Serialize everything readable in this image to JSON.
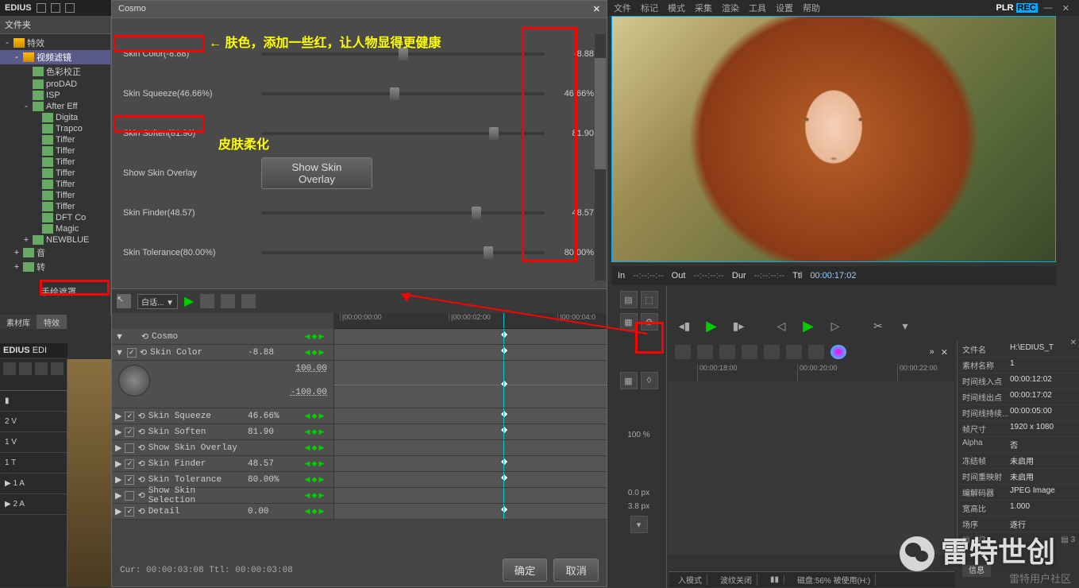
{
  "app": {
    "name": "EDIUS",
    "sub": "EDI"
  },
  "topmenu": [
    "文件",
    "标记",
    "模式",
    "采集",
    "渲染",
    "工具",
    "设置",
    "帮助"
  ],
  "plr": {
    "p": "PLR ",
    "rec": "REC"
  },
  "sidebar": {
    "header": "文件夹",
    "items": [
      {
        "indent": 0,
        "exp": "-",
        "ico": "folder",
        "label": "特效"
      },
      {
        "indent": 1,
        "exp": "-",
        "ico": "folder",
        "label": "视频滤镜",
        "sel": true
      },
      {
        "indent": 2,
        "exp": "",
        "ico": "fx",
        "label": "色彩校正"
      },
      {
        "indent": 2,
        "exp": "",
        "ico": "fx",
        "label": "proDAD"
      },
      {
        "indent": 2,
        "exp": "",
        "ico": "fx",
        "label": "ISP"
      },
      {
        "indent": 2,
        "exp": "-",
        "ico": "fx",
        "label": "After Eff"
      },
      {
        "indent": 3,
        "exp": "",
        "ico": "fx",
        "label": "Digita"
      },
      {
        "indent": 3,
        "exp": "",
        "ico": "fx",
        "label": "Trapco"
      },
      {
        "indent": 3,
        "exp": "",
        "ico": "fx",
        "label": "Tiffer"
      },
      {
        "indent": 3,
        "exp": "",
        "ico": "fx",
        "label": "Tiffer"
      },
      {
        "indent": 3,
        "exp": "",
        "ico": "fx",
        "label": "Tiffer"
      },
      {
        "indent": 3,
        "exp": "",
        "ico": "fx",
        "label": "Tiffer"
      },
      {
        "indent": 3,
        "exp": "",
        "ico": "fx",
        "label": "Tiffer"
      },
      {
        "indent": 3,
        "exp": "",
        "ico": "fx",
        "label": "Tiffer"
      },
      {
        "indent": 3,
        "exp": "",
        "ico": "fx",
        "label": "Tiffer"
      },
      {
        "indent": 3,
        "exp": "",
        "ico": "fx",
        "label": "DFT Co"
      },
      {
        "indent": 3,
        "exp": "",
        "ico": "fx",
        "label": "Magic"
      },
      {
        "indent": 2,
        "exp": "+",
        "ico": "fx",
        "label": "NEWBLUE"
      },
      {
        "indent": 1,
        "exp": "+",
        "ico": "fx",
        "label": "音"
      },
      {
        "indent": 1,
        "exp": "+",
        "ico": "fx",
        "label": "转"
      }
    ],
    "handdrawn_mask": "手绘遮罩",
    "tabs": [
      "素材库",
      "特效"
    ]
  },
  "cosmo": {
    "title": "Cosmo",
    "params": [
      {
        "label": "Skin Color(-8.88)",
        "pos": 50,
        "val": "-8.88"
      },
      {
        "label": "Skin Squeeze(46.66%)",
        "pos": 47,
        "val": "46.66%"
      },
      {
        "label": "Skin Soften(81.90)",
        "pos": 82,
        "val": "81.90"
      },
      {
        "label": "Show Skin Overlay",
        "button": "Show Skin Overlay"
      },
      {
        "label": "Skin Finder(48.57)",
        "pos": 76,
        "val": "48.57"
      },
      {
        "label": "Skin Tolerance(80.00%)",
        "pos": 80,
        "val": "80.00%"
      }
    ],
    "annotations": {
      "skin_color_note": "肤色，添加一些红，让人物显得更健康",
      "skin_soften_note": "皮肤柔化",
      "arrow_left": "←"
    }
  },
  "keyframes": {
    "dropdown": "白话... ▼",
    "ruler": [
      "|00:00:00:00",
      "|00:00:02:00",
      "|00:00:04:0"
    ],
    "header": "Cosmo",
    "rows": [
      {
        "chk": true,
        "name": "Skin Color",
        "val": "-8.88",
        "kf": 62
      },
      {
        "chk": true,
        "name": "Skin Squeeze",
        "val": "46.66%",
        "kf": 62
      },
      {
        "chk": true,
        "name": "Skin Soften",
        "val": "81.90",
        "kf": 62
      },
      {
        "chk": false,
        "name": "Show Skin Overlay",
        "val": "",
        "kf": null
      },
      {
        "chk": true,
        "name": "Skin Finder",
        "val": "48.57",
        "kf": 62
      },
      {
        "chk": true,
        "name": "Skin Tolerance",
        "val": "80.00%",
        "kf": 62
      },
      {
        "chk": false,
        "name": "Show Skin Selection",
        "val": "",
        "kf": null
      },
      {
        "chk": true,
        "name": "Detail",
        "val": "0.00",
        "kf": 62
      }
    ],
    "curve_max": "100.00",
    "curve_min": "-100.00",
    "status": "Cur: 00:00:03:08  Ttl: 00:00:03:08",
    "ok": "确定",
    "cancel": "取消"
  },
  "tc": {
    "in_l": "In",
    "in_v": "--:--:--:--",
    "out_l": "Out",
    "out_v": "--:--:--:--",
    "dur_l": "Dur",
    "dur_v": "--:--:--:--",
    "ttl_l": "Ttl",
    "ttl_v": "00:00:17:02"
  },
  "mid": {
    "pct": "100 %",
    "px1": "0.0 px",
    "px2": "3.8 px"
  },
  "timeline": {
    "ticks": [
      "00:00:18:00",
      "00:00:20:00",
      "00:00:22:00"
    ]
  },
  "info": {
    "rows": [
      {
        "k": "文件名",
        "v": "H:\\EDIUS_T"
      },
      {
        "k": "素材名称",
        "v": "1"
      },
      {
        "k": "时间线入点",
        "v": "00:00:12:02"
      },
      {
        "k": "时间线出点",
        "v": "00:00:17:02"
      },
      {
        "k": "时间线持续...",
        "v": "00:00:05:00"
      },
      {
        "k": "帧尺寸",
        "v": "1920 x 1080"
      },
      {
        "k": "Alpha",
        "v": "否"
      },
      {
        "k": "冻结帧",
        "v": "未启用"
      },
      {
        "k": "时间重映射",
        "v": "未启用"
      },
      {
        "k": "编解码器",
        "v": "JPEG Image"
      },
      {
        "k": "宽高比",
        "v": "1.000"
      },
      {
        "k": "场序",
        "v": "逐行"
      }
    ],
    "footer_count": "3/3",
    "footer_num": "3",
    "info_btn": "信息"
  },
  "tracks": [
    "2 V",
    "1 V",
    "1 T",
    "▶ 1 A",
    "▶ 2 A"
  ],
  "status": {
    "mode": "入模式",
    "wave": "波纹关闭",
    "disk": "磁盘:56% 被使用(H:)"
  },
  "watermark": "雷特世创",
  "watermark2": "雷特用户社区"
}
